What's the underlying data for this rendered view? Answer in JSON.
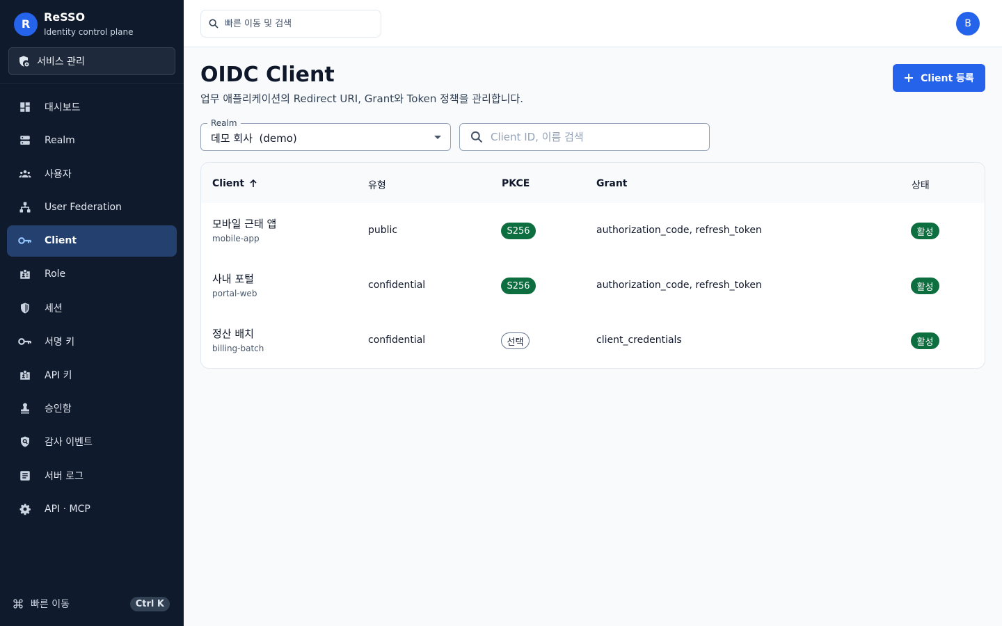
{
  "app": {
    "logo_letter": "R",
    "name": "ReSSO",
    "subtitle": "Identity control plane"
  },
  "service_button": "서비스 관리",
  "nav": [
    {
      "label": "대시보드",
      "icon": "dashboard-icon",
      "active": false
    },
    {
      "label": "Realm",
      "icon": "storage-icon",
      "active": false
    },
    {
      "label": "사용자",
      "icon": "users-icon",
      "active": false
    },
    {
      "label": "User Federation",
      "icon": "federation-icon",
      "active": false
    },
    {
      "label": "Client",
      "icon": "key-icon",
      "active": true
    },
    {
      "label": "Role",
      "icon": "badge-icon",
      "active": false
    },
    {
      "label": "세션",
      "icon": "shield-icon",
      "active": false
    },
    {
      "label": "서명 키",
      "icon": "key-icon",
      "active": false
    },
    {
      "label": "API 키",
      "icon": "badge-icon",
      "active": false
    },
    {
      "label": "승인함",
      "icon": "stamp-icon",
      "active": false
    },
    {
      "label": "감사 이벤트",
      "icon": "shield-search-icon",
      "active": false
    },
    {
      "label": "서버 로그",
      "icon": "log-icon",
      "active": false
    },
    {
      "label": "API · MCP",
      "icon": "gear-icon",
      "active": false
    }
  ],
  "footer": {
    "label": "빠른 이동",
    "shortcut": "Ctrl K"
  },
  "topbar": {
    "search_placeholder": "빠른 이동 및 검색",
    "avatar_letter": "B"
  },
  "page": {
    "title": "OIDC Client",
    "description": "업무 애플리케이션의 Redirect URI, Grant와 Token 정책을 관리합니다.",
    "add_button": "Client 등록"
  },
  "filters": {
    "realm_label": "Realm",
    "realm_value": "데모 회사  (demo)",
    "search_placeholder": "Client ID, 이름 검색"
  },
  "table": {
    "headers": {
      "client": "Client",
      "type": "유형",
      "pkce": "PKCE",
      "grant": "Grant",
      "status": "상태"
    },
    "rows": [
      {
        "name": "모바일 근태 앱",
        "id": "mobile-app",
        "type": "public",
        "pkce": "S256",
        "grant": "authorization_code, refresh_token",
        "status": "활성"
      },
      {
        "name": "사내 포털",
        "id": "portal-web",
        "type": "confidential",
        "pkce": "S256",
        "grant": "authorization_code, refresh_token",
        "status": "활성"
      },
      {
        "name": "정산 배치",
        "id": "billing-batch",
        "type": "confidential",
        "pkce": "선택",
        "grant": "client_credentials",
        "status": "활성"
      }
    ]
  },
  "colors": {
    "sidebar_bg": "#101a2d",
    "active_bg": "#24406e",
    "accent": "#2563eb",
    "success": "#0d6e3f"
  }
}
